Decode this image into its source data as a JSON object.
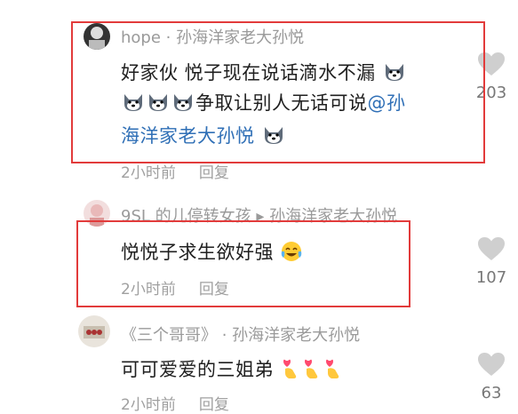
{
  "comments": [
    {
      "author": "hope · 孙海洋家老大孙悦",
      "lines": [
        "好家伙 悦子现在说话滴水不漏",
        "争取让别人无话可说",
        "海洋家老大孙悦"
      ],
      "mention_prefix": "@孙",
      "time": "2小时前",
      "reply": "回复",
      "likes": "203"
    },
    {
      "author": "9SL 的儿停转女孩 ▸ 孙海洋家老大孙悦",
      "text": "悦悦子求生欲好强",
      "time": "2小时前",
      "reply": "回复",
      "likes": "107"
    },
    {
      "author": "《三个哥哥》 · 孙海洋家老大孙悦",
      "text": "可可爱爱的三姐弟",
      "time": "2小时前",
      "reply": "回复",
      "likes": "63"
    }
  ],
  "colors": {
    "highlight_border": "#e23b3b",
    "mention": "#2f6fb6"
  },
  "icons": [
    "heart-icon",
    "husky-emoji",
    "tearful-laugh-emoji",
    "finger-heart-emoji"
  ]
}
